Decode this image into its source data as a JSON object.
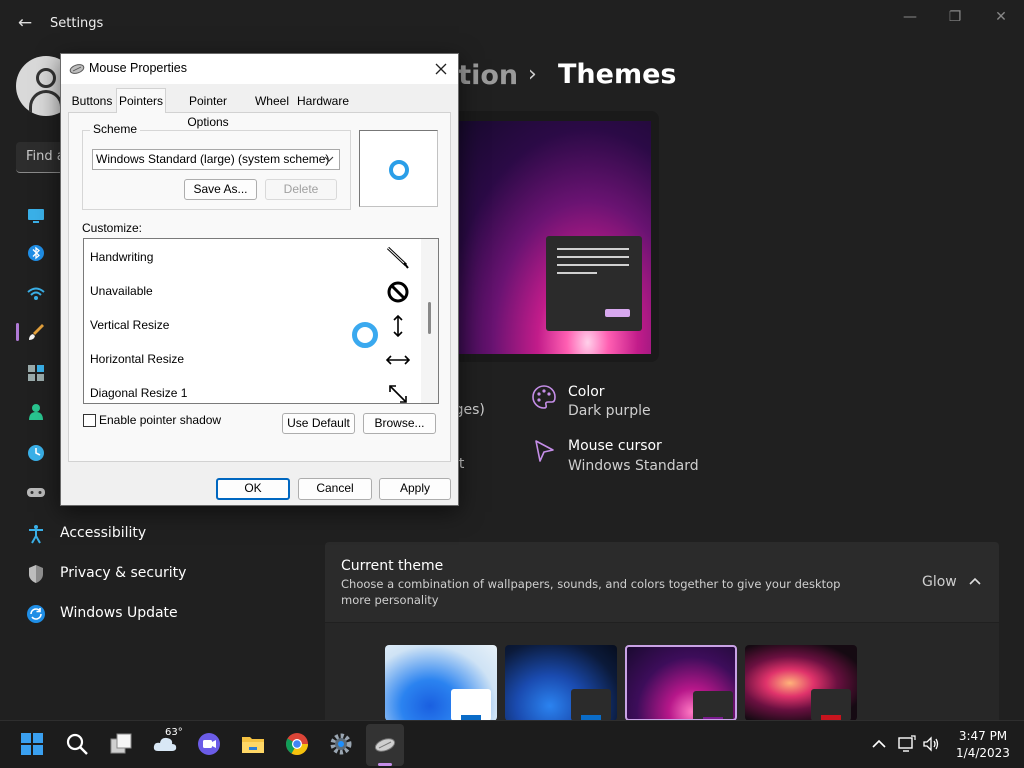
{
  "settings": {
    "title": "Settings",
    "search_placeholder": "Find a",
    "breadcrumb_parent": "ation",
    "page_title": "Themes",
    "nav": [
      {
        "label": "Accessibility"
      },
      {
        "label": "Privacy & security"
      },
      {
        "label": "Windows Update"
      }
    ],
    "tiles": {
      "color_title": "Color",
      "color_value": "Dark purple",
      "cursor_title": "Mouse cursor",
      "cursor_value": "Windows Standard",
      "background_fragment": "ages)",
      "sounds_fragment": "lt"
    },
    "current_theme": {
      "title": "Current theme",
      "description": "Choose a combination of wallpapers, sounds, and colors together to give your desktop more personality",
      "value": "Glow"
    },
    "accent_color": "#b07ad6"
  },
  "dialog": {
    "title": "Mouse Properties",
    "tabs": [
      {
        "label": "Buttons"
      },
      {
        "label": "Pointers"
      },
      {
        "label": "Pointer Options"
      },
      {
        "label": "Wheel"
      },
      {
        "label": "Hardware"
      }
    ],
    "active_tab": "Pointers",
    "scheme_label": "Scheme",
    "scheme_value": "Windows Standard (large) (system scheme)",
    "save_as_label": "Save As...",
    "delete_label": "Delete",
    "customize_label": "Customize:",
    "cursors": [
      {
        "name": "Handwriting",
        "icon": "pen-cursor-icon"
      },
      {
        "name": "Unavailable",
        "icon": "unavailable-cursor-icon"
      },
      {
        "name": "Vertical Resize",
        "icon": "vertical-resize-cursor-icon"
      },
      {
        "name": "Horizontal Resize",
        "icon": "horizontal-resize-cursor-icon"
      },
      {
        "name": "Diagonal Resize 1",
        "icon": "diagonal-resize-cursor-icon"
      }
    ],
    "pointer_shadow_label": "Enable pointer shadow",
    "pointer_shadow_checked": false,
    "use_default_label": "Use Default",
    "browse_label": "Browse...",
    "ok_label": "OK",
    "cancel_label": "Cancel",
    "apply_label": "Apply"
  },
  "taskbar": {
    "weather_temp": "63°",
    "time": "3:47 PM",
    "date": "1/4/2023"
  }
}
